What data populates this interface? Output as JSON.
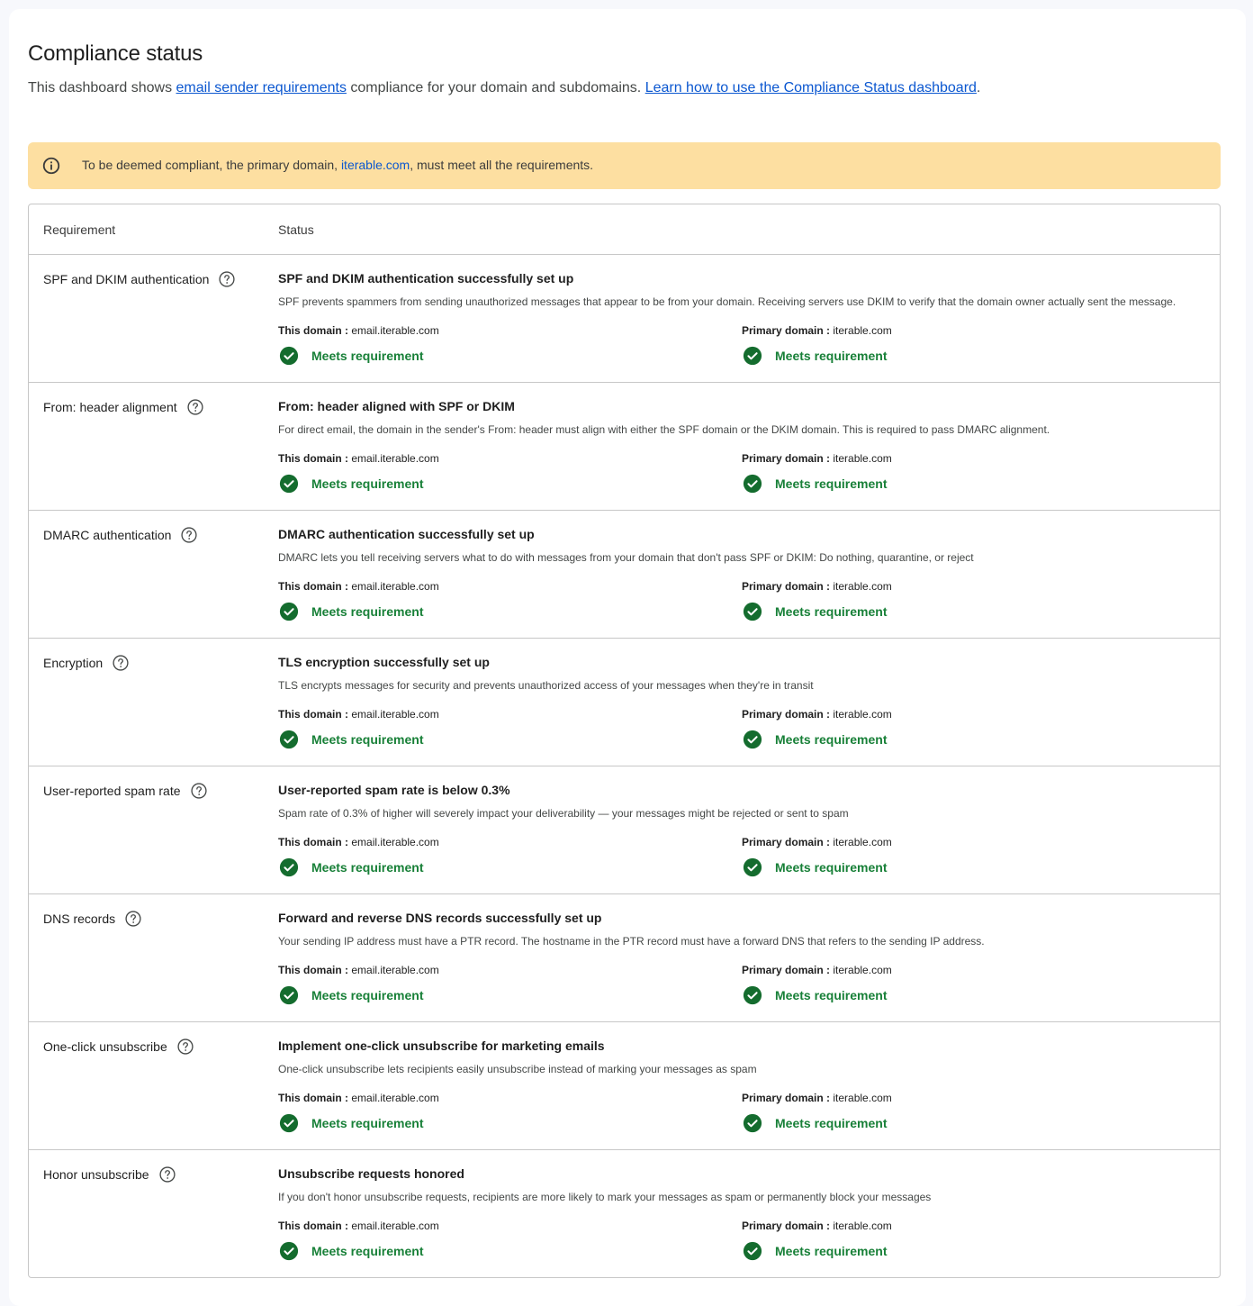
{
  "page": {
    "title": "Compliance status",
    "subtitle_prefix": "This dashboard shows ",
    "subtitle_link1": "email sender requirements",
    "subtitle_middle": " compliance for your domain and subdomains. ",
    "subtitle_link2": "Learn how to use the Compliance Status dashboard",
    "subtitle_suffix": "."
  },
  "banner": {
    "icon": "info-icon",
    "text_prefix": "To be deemed compliant, the primary domain, ",
    "domain_link": "iterable.com",
    "text_suffix": ", must meet all the requirements.",
    "background": "#fddfa1"
  },
  "table": {
    "headers": {
      "requirement": "Requirement",
      "status": "Status"
    },
    "this_domain_label": "This domain :",
    "primary_domain_label": "Primary domain :",
    "this_domain": "email.iterable.com",
    "primary_domain": "iterable.com",
    "status_color": "#188038",
    "rows": [
      {
        "requirement": "SPF and DKIM authentication",
        "status_title": "SPF and DKIM authentication successfully set up",
        "description": "SPF prevents spammers from sending unauthorized messages that appear to be from your domain. Receiving servers use DKIM to verify that the domain owner actually sent the message.",
        "this_status": "Meets requirement",
        "primary_status": "Meets requirement"
      },
      {
        "requirement": "From: header alignment",
        "status_title": "From: header aligned with SPF or DKIM",
        "description": "For direct email, the domain in the sender's From: header must align with either the SPF domain or the DKIM domain. This is required to pass DMARC alignment.",
        "this_status": "Meets requirement",
        "primary_status": "Meets requirement"
      },
      {
        "requirement": "DMARC authentication",
        "status_title": "DMARC authentication successfully set up",
        "description": "DMARC lets you tell receiving servers what to do with messages from your domain that don't pass SPF or DKIM: Do nothing, quarantine, or reject",
        "this_status": "Meets requirement",
        "primary_status": "Meets requirement"
      },
      {
        "requirement": "Encryption",
        "status_title": "TLS encryption successfully set up",
        "description": "TLS encrypts messages for security and prevents unauthorized access of your messages when they're in transit",
        "this_status": "Meets requirement",
        "primary_status": "Meets requirement"
      },
      {
        "requirement": "User-reported spam rate",
        "status_title": "User-reported spam rate is below 0.3%",
        "description": "Spam rate of 0.3% of higher will severely impact your deliverability — your messages might be rejected or sent to spam",
        "this_status": "Meets requirement",
        "primary_status": "Meets requirement"
      },
      {
        "requirement": "DNS records",
        "status_title": "Forward and reverse DNS records successfully set up",
        "description": "Your sending IP address must have a PTR record. The hostname in the PTR record must have a forward DNS that refers to the sending IP address.",
        "this_status": "Meets requirement",
        "primary_status": "Meets requirement"
      },
      {
        "requirement": "One-click unsubscribe",
        "status_title": "Implement one-click unsubscribe for marketing emails",
        "description": "One-click unsubscribe lets recipients easily unsubscribe instead of marking your messages as spam",
        "this_status": "Meets requirement",
        "primary_status": "Meets requirement"
      },
      {
        "requirement": "Honor unsubscribe",
        "status_title": "Unsubscribe requests honored",
        "description": "If you don't honor unsubscribe requests, recipients are more likely to mark your messages as spam or permanently block your messages",
        "this_status": "Meets requirement",
        "primary_status": "Meets requirement"
      }
    ]
  }
}
